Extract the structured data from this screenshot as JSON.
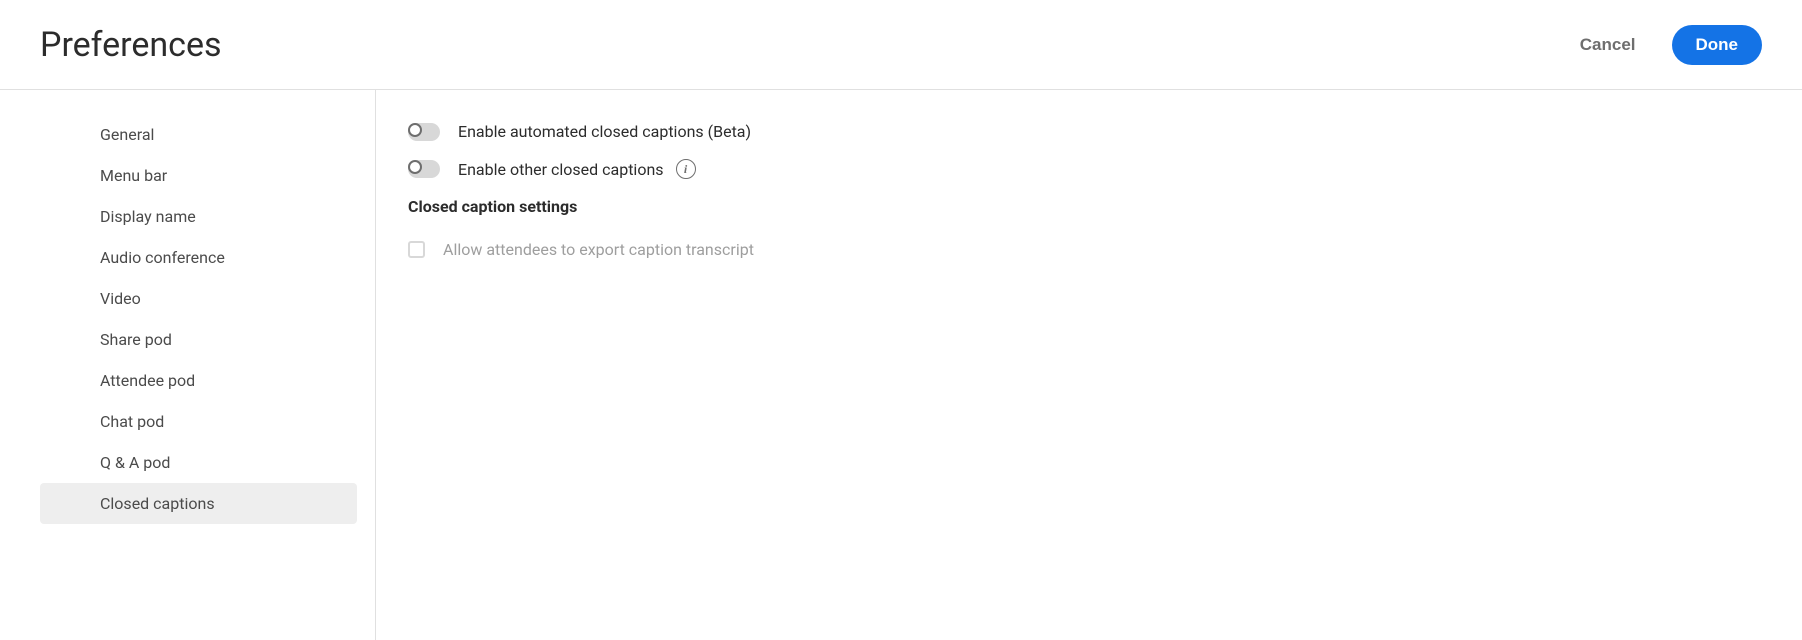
{
  "header": {
    "title": "Preferences",
    "cancel_label": "Cancel",
    "done_label": "Done"
  },
  "sidebar": {
    "items": [
      {
        "label": "General"
      },
      {
        "label": "Menu bar"
      },
      {
        "label": "Display name"
      },
      {
        "label": "Audio conference"
      },
      {
        "label": "Video"
      },
      {
        "label": "Share pod"
      },
      {
        "label": "Attendee pod"
      },
      {
        "label": "Chat pod"
      },
      {
        "label": "Q & A pod"
      },
      {
        "label": "Closed captions"
      }
    ],
    "selected_index": 9
  },
  "content": {
    "toggle1_label": "Enable automated closed captions (Beta)",
    "toggle1_on": false,
    "toggle2_label": "Enable other closed captions",
    "toggle2_on": false,
    "section_heading": "Closed caption settings",
    "checkbox1_label": "Allow attendees to export caption transcript",
    "checkbox1_checked": false,
    "checkbox1_disabled": true
  }
}
